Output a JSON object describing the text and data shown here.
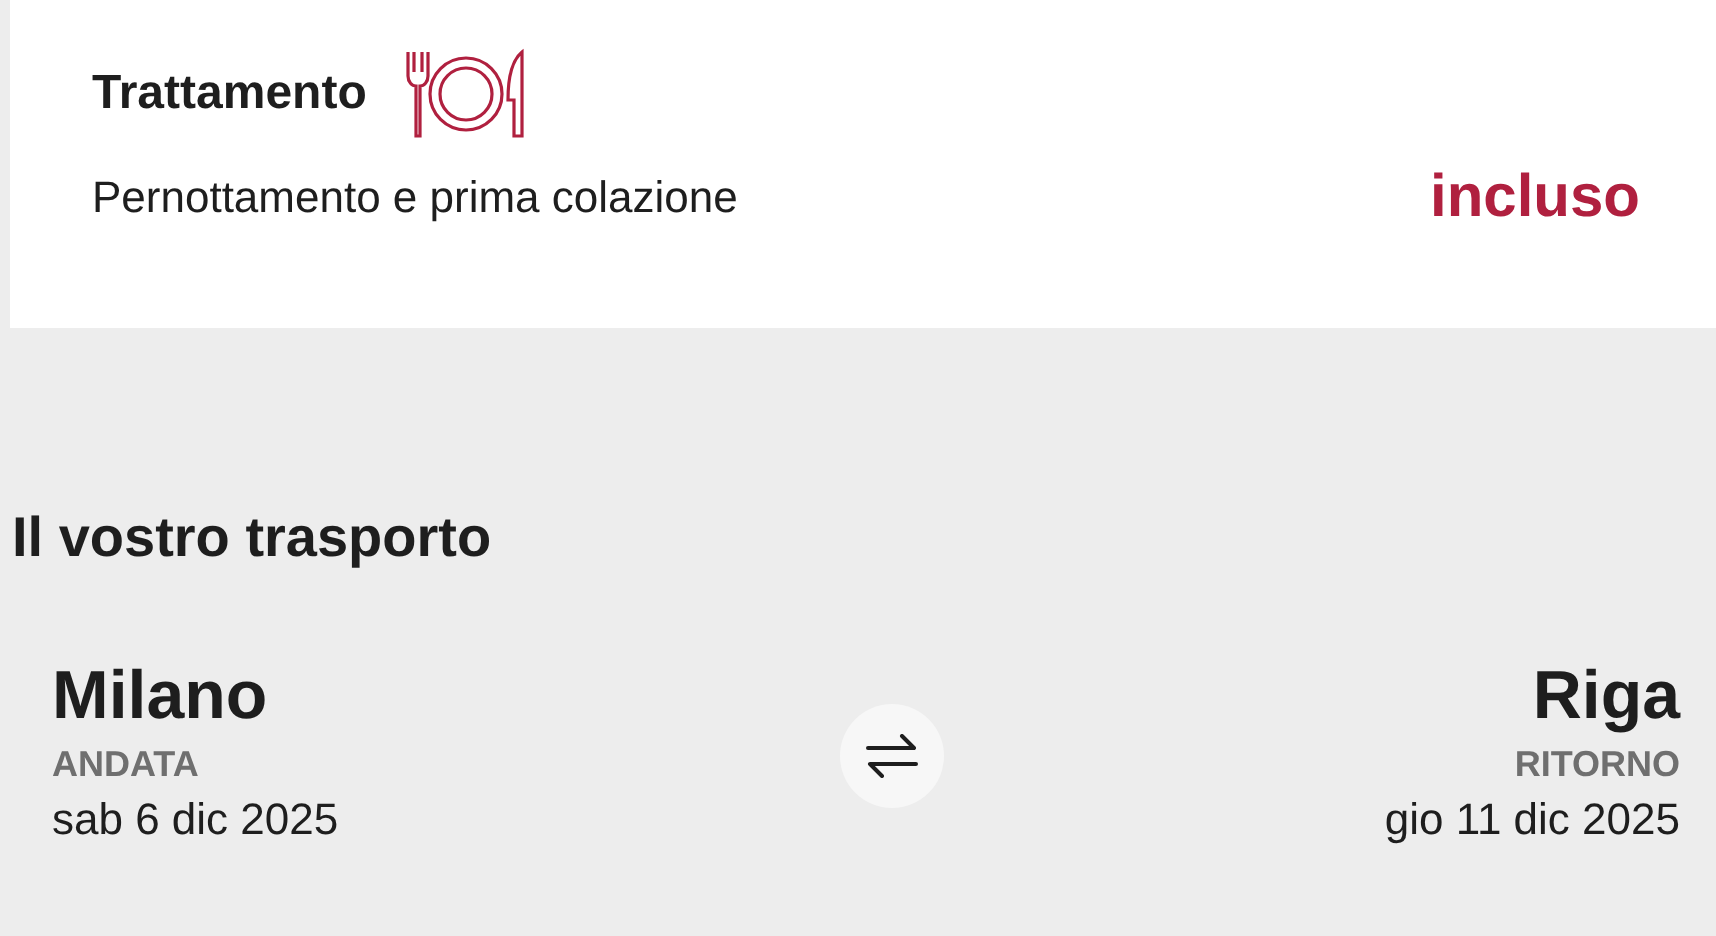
{
  "board": {
    "title": "Trattamento",
    "description": "Pernottamento e prima colazione",
    "status": "incluso"
  },
  "transport": {
    "title": "Il vostro trasporto",
    "legs": [
      {
        "city": "Milano",
        "label": "ANDATA",
        "date": "sab 6 dic 2025"
      },
      {
        "city": "Riga",
        "label": "RITORNO",
        "date": "gio 11 dic 2025"
      }
    ]
  }
}
